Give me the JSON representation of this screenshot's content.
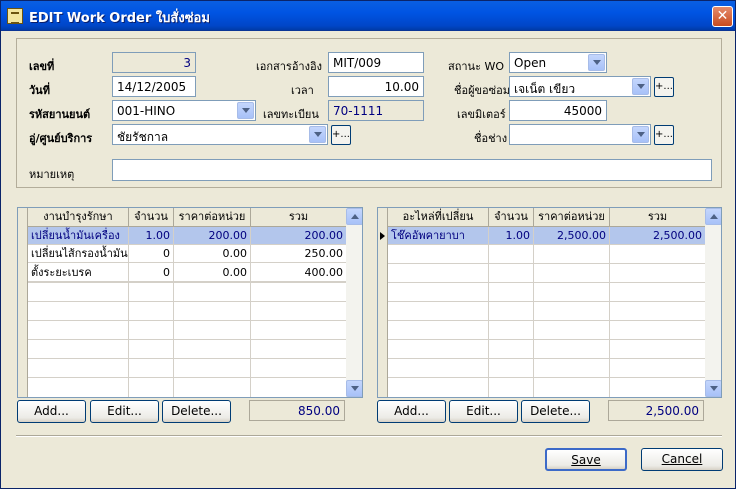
{
  "window": {
    "title": "EDIT Work Order  ใบสั่งซ่อม"
  },
  "header": {
    "doc_no_label": "เลขที่",
    "doc_no_value": "3",
    "ref_doc_label": "เอกสารอ้างอิง",
    "ref_doc_value": "MIT/009",
    "status_label": "สถานะ WO",
    "status_value": "Open",
    "date_label": "วันที่",
    "date_value": "14/12/2005",
    "time_label": "เวลา",
    "time_value": "10.00",
    "requester_label": "ชื่อผู้ขอซ่อม",
    "requester_value": "เจเน็ต เขียว",
    "vehicle_label": "รหัสยานยนต์",
    "vehicle_value": "001-HINO",
    "plate_label": "เลขทะเบียน",
    "plate_value": "70-1111",
    "mileage_label": "เลขมิเตอร์",
    "mileage_value": "45000",
    "garage_label": "อู่/ศูนย์บริการ",
    "garage_value": "ชัยรัชกาล",
    "mechanic_label": "ชื่อช่าง",
    "mechanic_value": "",
    "plus_label": "+...",
    "remark_label": "หมายเหตุ",
    "remark_value": ""
  },
  "services": {
    "columns": [
      "งานบำรุงรักษา",
      "จำนวน",
      "ราคาต่อหน่วย",
      "รวม"
    ],
    "rows": [
      [
        "เปลี่ยนน้ำมันเครื่อง",
        "1.00",
        "200.00",
        "200.00"
      ],
      [
        "เปลี่ยนไส้กรองน้ำมันเ",
        "0",
        "0.00",
        "250.00"
      ],
      [
        "ตั้งระยะเบรค",
        "0",
        "0.00",
        "400.00"
      ]
    ],
    "add_label": "Add...",
    "edit_label": "Edit...",
    "delete_label": "Delete...",
    "total": "850.00"
  },
  "parts": {
    "columns": [
      "อะไหล่ที่เปลี่ยน",
      "จำนวน",
      "ราคาต่อหน่วย",
      "รวม"
    ],
    "rows": [
      [
        "โช๊คอัพคายาบา",
        "1.00",
        "2,500.00",
        "2,500.00"
      ]
    ],
    "add_label": "Add...",
    "edit_label": "Edit...",
    "delete_label": "Delete...",
    "total": "2,500.00"
  },
  "footer": {
    "save_label": "Save",
    "cancel_label": "Cancel"
  }
}
